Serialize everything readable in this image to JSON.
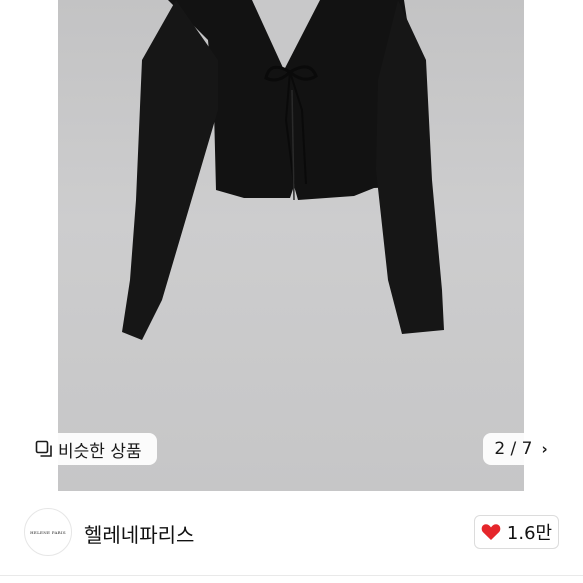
{
  "gallery": {
    "similar_label": "비슷한 상품",
    "counter": "2 / 7",
    "counter_icon": "chevron-right-icon"
  },
  "seller": {
    "avatar_text": "HELENE PARIS",
    "name": "헬레네파리스"
  },
  "like": {
    "count": "1.6만",
    "icon": "heart-icon",
    "heart_color": "#e5262b"
  }
}
